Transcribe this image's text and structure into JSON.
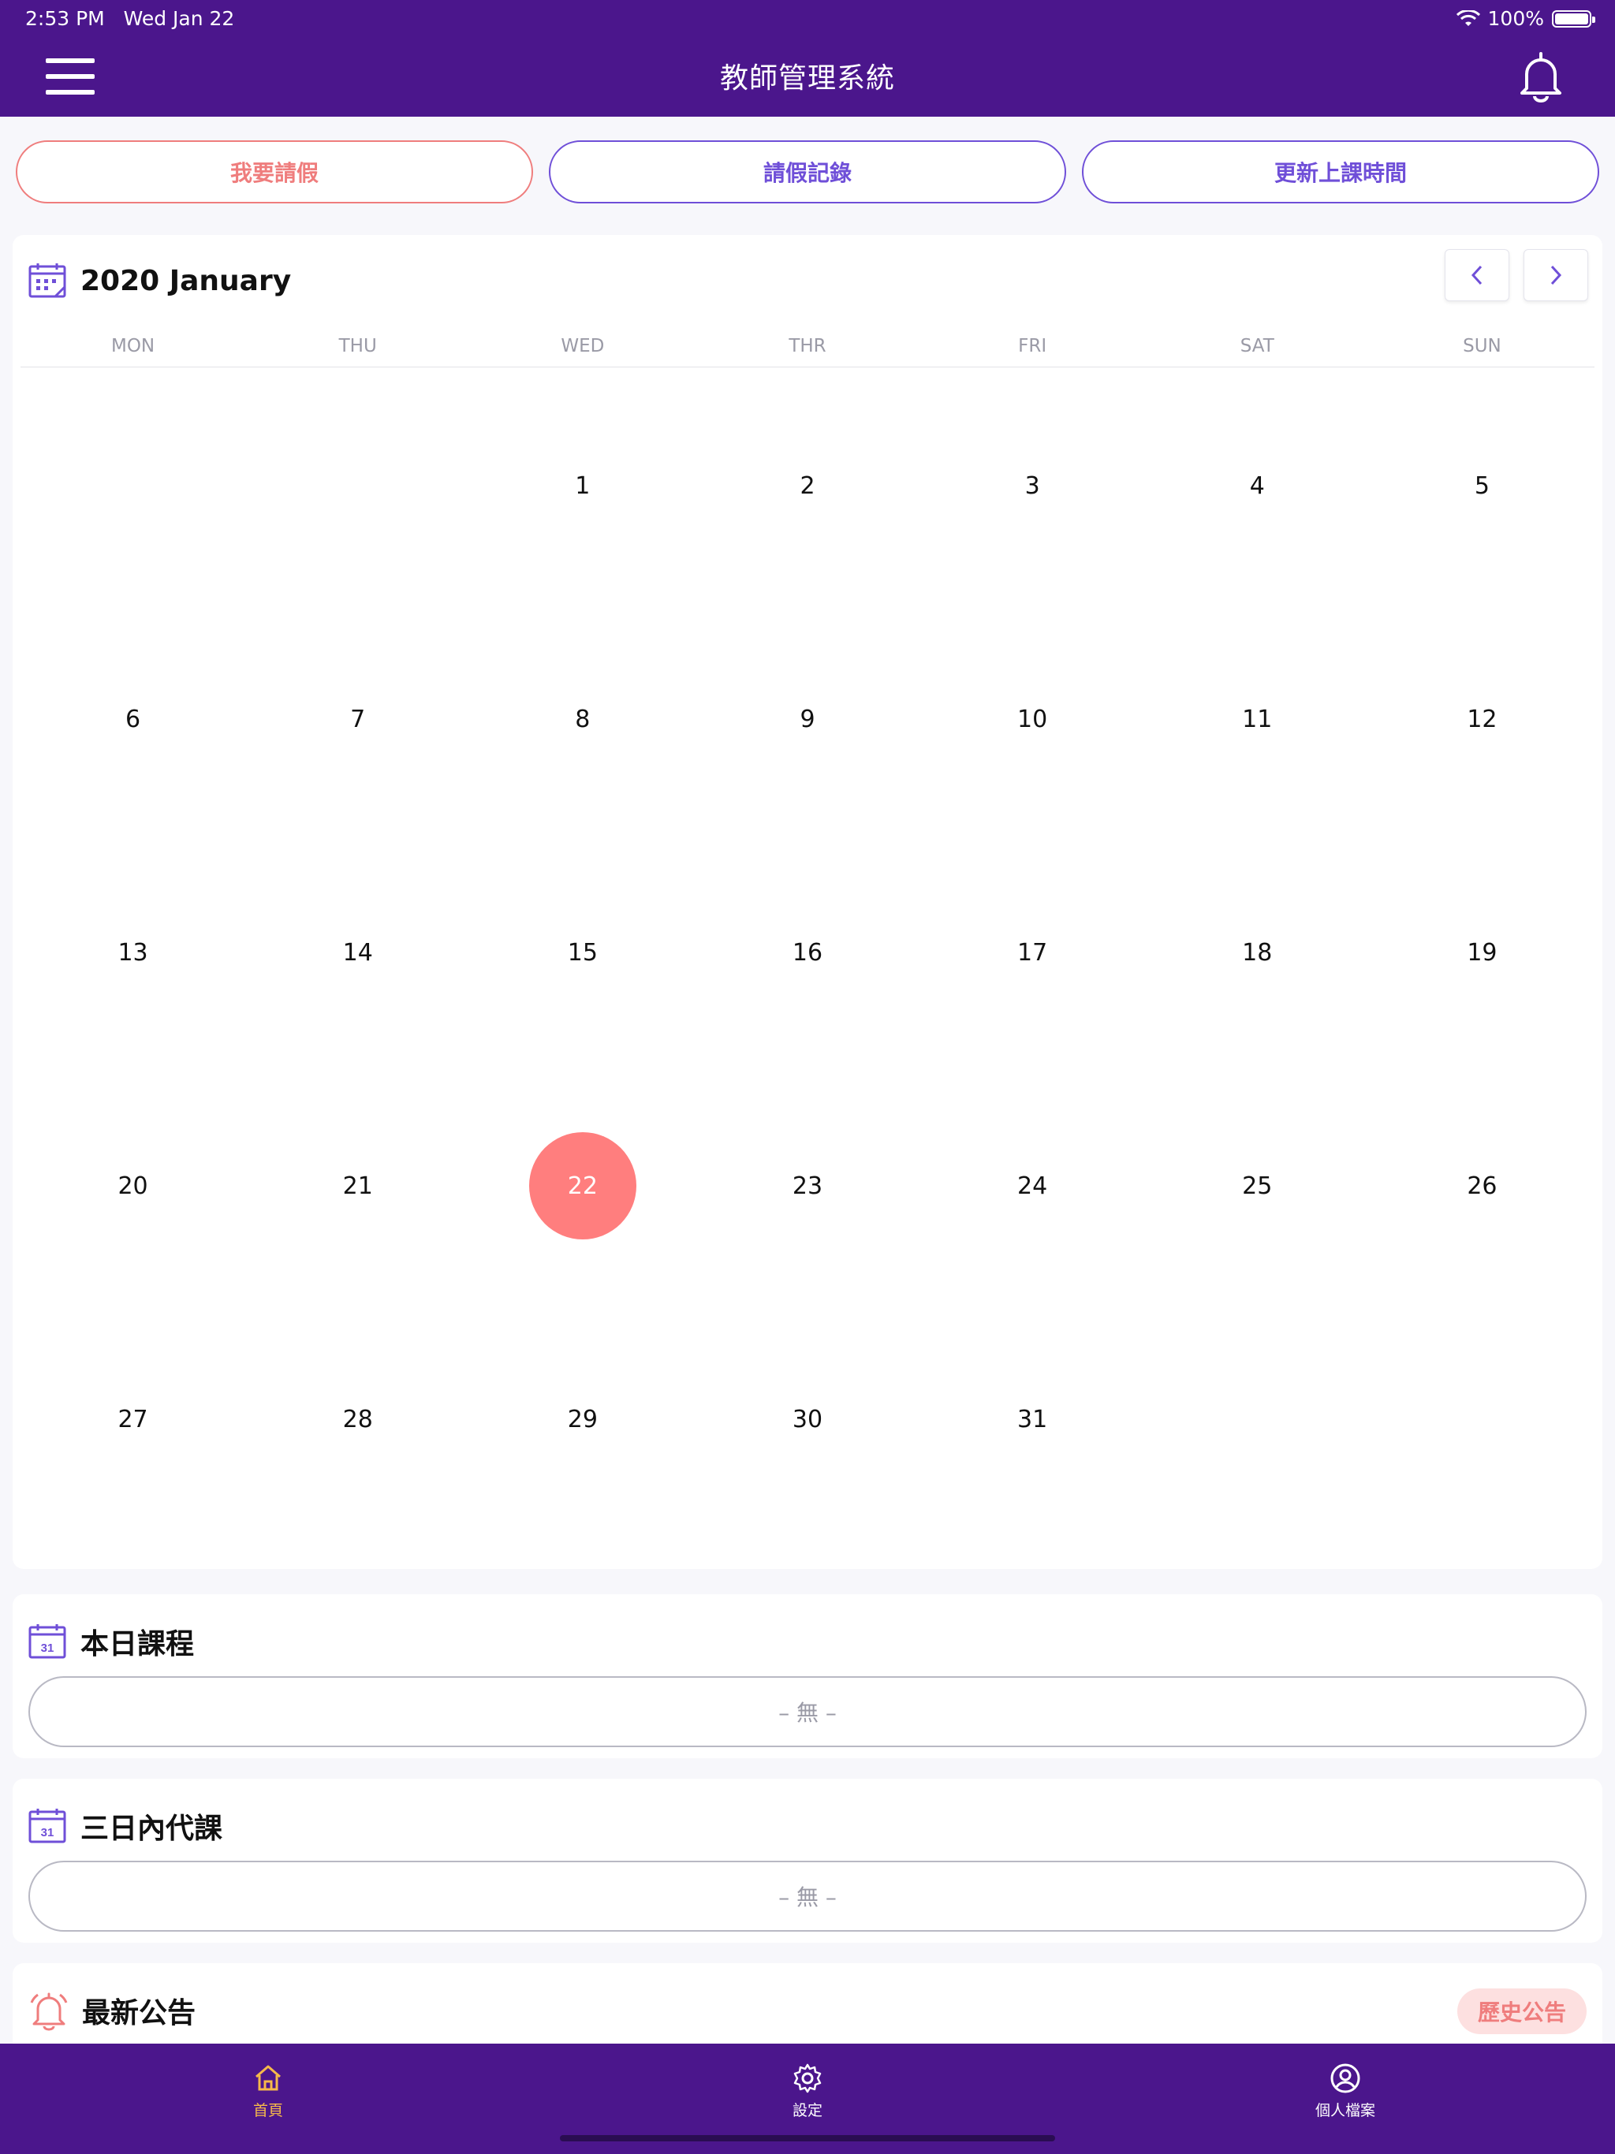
{
  "status": {
    "time": "2:53 PM",
    "date": "Wed Jan 22",
    "battery": "100%"
  },
  "header": {
    "title": "教師管理系統"
  },
  "actions": {
    "leave": "我要請假",
    "records": "請假記錄",
    "update": "更新上課時間"
  },
  "calendar": {
    "title": "2020 January",
    "weekdays": [
      "MON",
      "THU",
      "WED",
      "THR",
      "FRI",
      "SAT",
      "SUN"
    ],
    "days": [
      "",
      "",
      "1",
      "2",
      "3",
      "4",
      "5",
      "6",
      "7",
      "8",
      "9",
      "10",
      "11",
      "12",
      "13",
      "14",
      "15",
      "16",
      "17",
      "18",
      "19",
      "20",
      "21",
      "22",
      "23",
      "24",
      "25",
      "26",
      "27",
      "28",
      "29",
      "30",
      "31",
      "",
      "",
      ""
    ],
    "today": "22"
  },
  "today_courses": {
    "title": "本日課程",
    "empty": "– 無 –"
  },
  "substitute": {
    "title": "三日內代課",
    "empty": "– 無 –"
  },
  "announcements": {
    "title": "最新公告",
    "history": "歷史公告"
  },
  "tabbar": {
    "home": "首頁",
    "settings": "設定",
    "profile": "個人檔案"
  },
  "colors": {
    "primary": "#4b168c",
    "accent": "#6f4fd8",
    "coral": "#ff7e7e",
    "tab_active": "#f6b94a"
  }
}
